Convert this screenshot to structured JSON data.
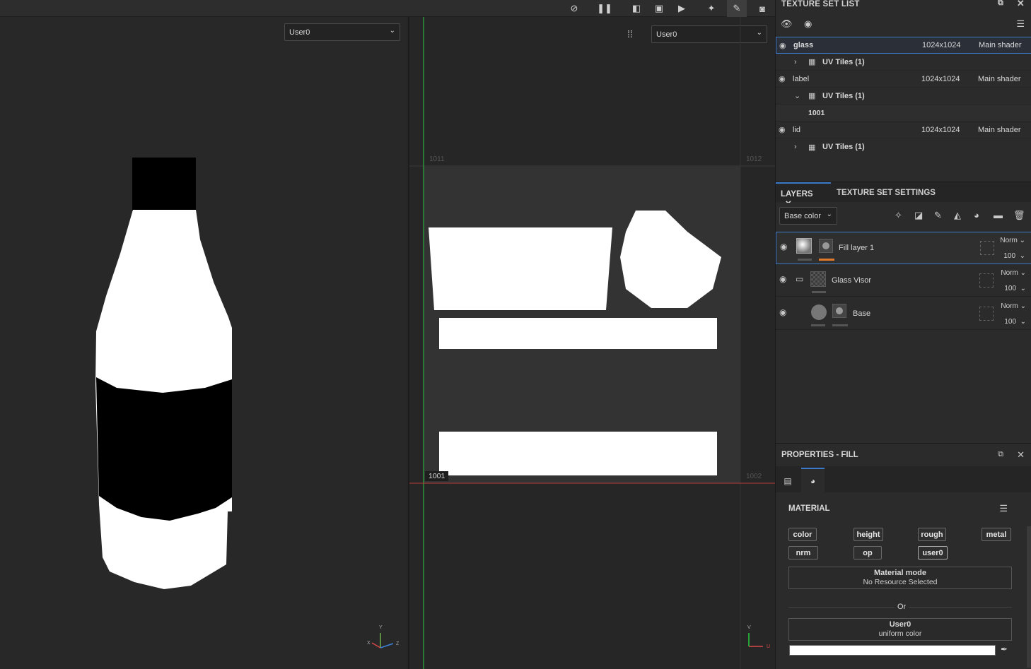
{
  "viewport3d": {
    "channel_select": "User0"
  },
  "viewport2d": {
    "channel_select": "User0",
    "uv_tile_labels": {
      "bottom_left": "1001",
      "bottom_right": "1002",
      "top_left": "1011",
      "top_right": "1012"
    }
  },
  "texture_set_list": {
    "title": "TEXTURE SET LIST",
    "sets": [
      {
        "name": "glass",
        "resolution": "1024x1024",
        "shader": "Main shader",
        "uv_label": "UV Tiles (1)",
        "expanded": false
      },
      {
        "name": "label",
        "resolution": "1024x1024",
        "shader": "Main shader",
        "uv_label": "UV Tiles (1)",
        "expanded": true,
        "tile": "1001"
      },
      {
        "name": "lid",
        "resolution": "1024x1024",
        "shader": "Main shader",
        "uv_label": "UV Tiles (1)",
        "expanded": false
      }
    ]
  },
  "layers_panel": {
    "tab_layers": "LAYERS",
    "tab_settings": "TEXTURE SET SETTINGS",
    "channel": "Base color",
    "layers": [
      {
        "name": "Fill layer 1",
        "blend": "Norm",
        "opacity": "100"
      },
      {
        "name": "Glass Visor",
        "blend": "Norm",
        "opacity": "100"
      },
      {
        "name": "Base",
        "blend": "Norm",
        "opacity": "100"
      }
    ]
  },
  "properties": {
    "title": "PROPERTIES - FILL",
    "section": "MATERIAL",
    "channels": [
      "color",
      "height",
      "rough",
      "metal",
      "nrm",
      "op",
      "user0"
    ],
    "material_mode_title": "Material mode",
    "material_mode_value": "No Resource Selected",
    "or_label": "Or",
    "user_channel_title": "User0",
    "user_channel_value": "uniform color",
    "colors": {
      "accent": "#3a7ac8",
      "mask_marker": "#e07a2c"
    }
  }
}
